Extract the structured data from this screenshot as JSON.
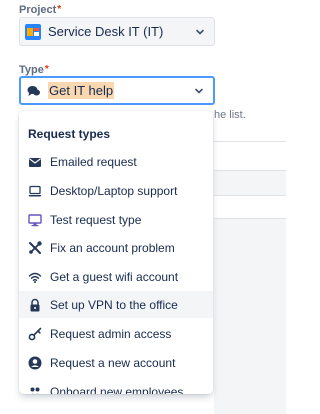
{
  "form": {
    "project_label": "Project",
    "type_label": "Type",
    "required_marker": "*",
    "project_value": "Service Desk IT (IT)",
    "type_value": "Get IT help",
    "hint_text": "he list."
  },
  "dropdown": {
    "group_heading": "Request types",
    "items": [
      {
        "label": "Emailed request",
        "icon": "envelope-icon"
      },
      {
        "label": "Desktop/Laptop support",
        "icon": "laptop-icon"
      },
      {
        "label": "Test request type",
        "icon": "monitor-icon"
      },
      {
        "label": "Fix an account problem",
        "icon": "tools-icon"
      },
      {
        "label": "Get a guest wifi account",
        "icon": "wifi-icon"
      },
      {
        "label": "Set up VPN to the office",
        "icon": "lock-icon",
        "highlighted": true
      },
      {
        "label": "Request admin access",
        "icon": "key-icon"
      },
      {
        "label": "Request a new account",
        "icon": "user-circle-icon"
      },
      {
        "label": "Onboard new employees",
        "icon": "people-icon"
      }
    ]
  },
  "colors": {
    "focus_border": "#4c9aff",
    "selected_text_highlight": "#f9d7b1",
    "hover_row": "#f4f5f7",
    "required": "#de350b"
  }
}
